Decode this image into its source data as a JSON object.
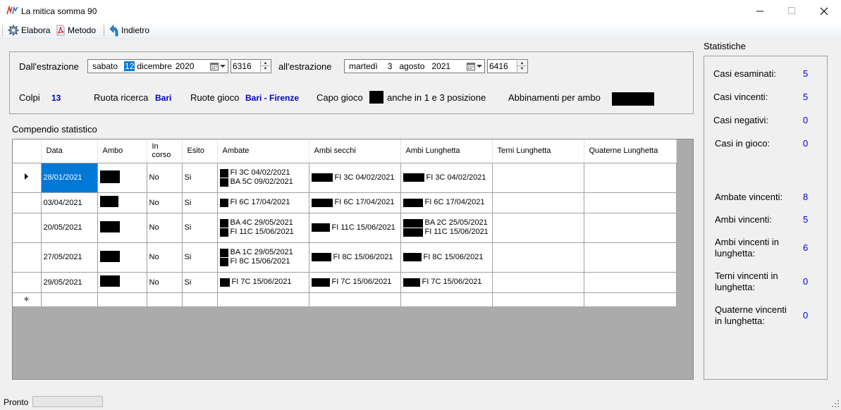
{
  "window": {
    "title": "La mitica somma 90"
  },
  "toolbar": {
    "elabora": "Elabora",
    "metodo": "Metodo",
    "indietro": "Indietro"
  },
  "params": {
    "from_label": "Dall'estrazione",
    "from_weekday": "sabato",
    "from_day": "12",
    "from_month": "dicembre",
    "from_year": "2020",
    "from_number": "6316",
    "to_label": "all'estrazione",
    "to_weekday": "martedì",
    "to_day": "3",
    "to_month": "agosto",
    "to_year": "2021",
    "to_number": "6416",
    "colpi_label": "Colpi",
    "colpi_value": "13",
    "ruota_ricerca_label": "Ruota ricerca",
    "ruota_ricerca_value": "Bari",
    "ruote_gioco_label": "Ruote gioco",
    "ruote_gioco_value": "Bari - Firenze",
    "capo_gioco_label": "Capo gioco",
    "anche_label": "anche in 1 e 3 posizione",
    "abbinamenti_label": "Abbinamenti per ambo"
  },
  "compendio": {
    "title": "Compendio statistico",
    "columns": [
      "Data",
      "Ambo",
      "In corso",
      "Esito",
      "Ambate",
      "Ambi secchi",
      "Ambi Lunghetta",
      "Terni Lunghetta",
      "Quaterne Lunghetta"
    ],
    "rows": [
      {
        "data": "28/01/2021",
        "in_corso": "No",
        "esito": "Si",
        "ambate": [
          "FI 3C 04/02/2021",
          "BA 5C 09/02/2021"
        ],
        "ambi_secchi": [
          "FI 3C 04/02/2021"
        ],
        "ambi_lunghetta": [
          "FI 3C 04/02/2021"
        ]
      },
      {
        "data": "03/04/2021",
        "in_corso": "No",
        "esito": "Si",
        "ambate": [
          "FI 6C 17/04/2021"
        ],
        "ambi_secchi": [
          "FI 6C 17/04/2021"
        ],
        "ambi_lunghetta": [
          "FI 6C 17/04/2021"
        ]
      },
      {
        "data": "20/05/2021",
        "in_corso": "No",
        "esito": "Si",
        "ambate": [
          "BA 4C 29/05/2021",
          "FI 11C 15/06/2021"
        ],
        "ambi_secchi": [
          "FI 11C 15/06/2021"
        ],
        "ambi_lunghetta": [
          "BA 2C 25/05/2021",
          "FI 11C 15/06/2021"
        ]
      },
      {
        "data": "27/05/2021",
        "in_corso": "No",
        "esito": "Si",
        "ambate": [
          "BA 1C 29/05/2021",
          "FI 8C 15/06/2021"
        ],
        "ambi_secchi": [
          "FI 8C 15/06/2021"
        ],
        "ambi_lunghetta": [
          "FI 8C 15/06/2021"
        ]
      },
      {
        "data": "29/05/2021",
        "in_corso": "No",
        "esito": "Si",
        "ambate": [
          "FI 7C 15/06/2021"
        ],
        "ambi_secchi": [
          "FI 7C 15/06/2021"
        ],
        "ambi_lunghetta": [
          "FI 7C 15/06/2021"
        ]
      }
    ]
  },
  "statistiche": {
    "title": "Statistiche",
    "casi_esaminati_label": "Casi esaminati:",
    "casi_esaminati": "5",
    "casi_vincenti_label": "Casi vincenti:",
    "casi_vincenti": "5",
    "casi_negativi_label": "Casi negativi:",
    "casi_negativi": "0",
    "casi_in_gioco_label": "Casi in gioco:",
    "casi_in_gioco": "0",
    "ambate_vincenti_label": "Ambate vincenti:",
    "ambate_vincenti": "8",
    "ambi_vincenti_label": "Ambi vincenti:",
    "ambi_vincenti": "5",
    "ambi_lunghetta_label1": "Ambi vincenti in",
    "ambi_lunghetta_label2": "lunghetta:",
    "ambi_lunghetta": "6",
    "terni_lunghetta_label1": "Terni vincenti in",
    "terni_lunghetta_label2": "lunghetta:",
    "terni_lunghetta": "0",
    "quaterne_lunghetta_label1": "Quaterne vincenti",
    "quaterne_lunghetta_label2": "in lunghetta:",
    "quaterne_lunghetta": "0"
  },
  "status": {
    "text": "Pronto"
  }
}
